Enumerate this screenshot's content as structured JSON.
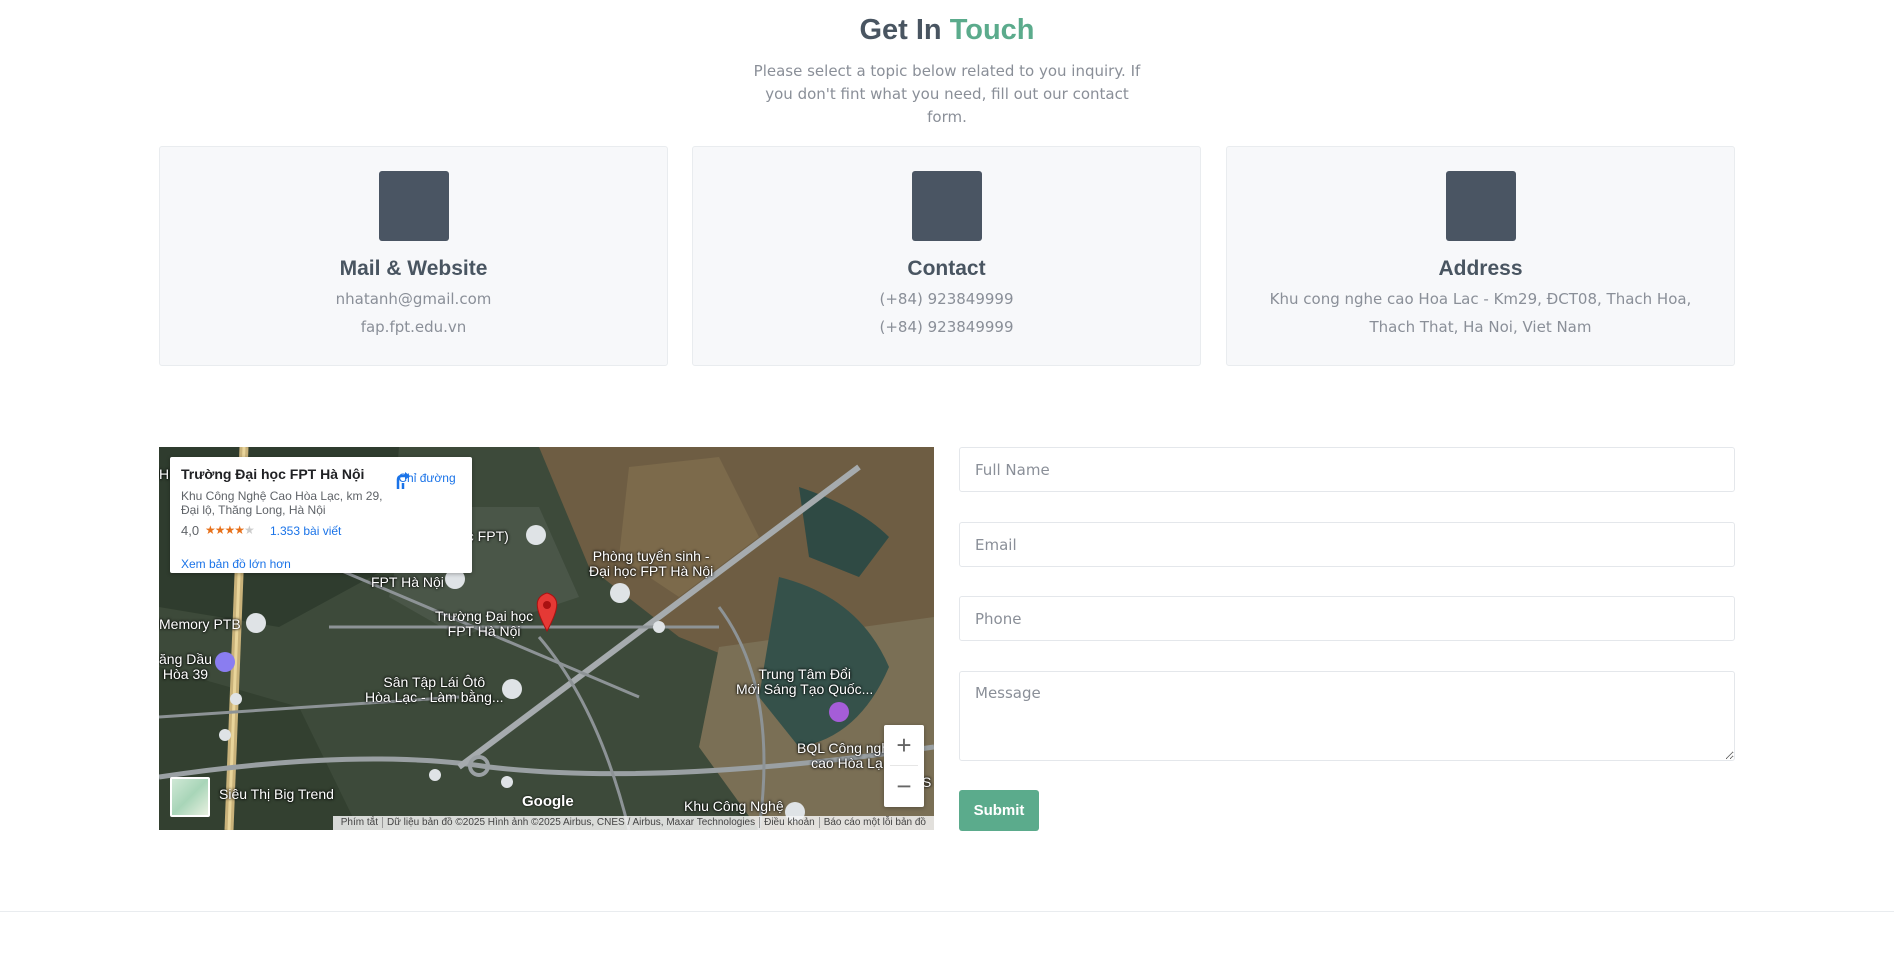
{
  "heading": {
    "part1": "Get In",
    "part2": "Touch"
  },
  "subtitle": "Please select a topic below related to you inquiry. If you don't fint what you need, fill out our contact form.",
  "cards": [
    {
      "title": "Mail & Website",
      "lines": [
        "nhatanh@gmail.com",
        "fap.fpt.edu.vn"
      ]
    },
    {
      "title": "Contact",
      "lines": [
        "(+84) 923849999",
        "(+84) 923849999"
      ]
    },
    {
      "title": "Address",
      "lines": [
        "Khu cong nghe cao Hoa Lac - Km29, ĐCT08, Thach Hoa, Thach That, Ha Noi, Viet Nam"
      ]
    }
  ],
  "map": {
    "place_name": "Trường Đại học FPT Hà Nội",
    "place_address": "Khu Công Nghệ Cao Hòa Lạc, km 29, Đại lộ, Thăng Long, Hà Nội",
    "rating": "4,0",
    "stars": "★★★★",
    "star_dim": "★",
    "reviews": "1.353 bài viết",
    "directions": "Chỉ đường",
    "bigger_map": "Xem bản đồ lớn hơn",
    "labels": {
      "fpt_top": "ọc FPT)",
      "admissions": "Phòng tuyển sinh -\nĐại học FPT Hà Nội",
      "fpt_left": "FPT Hà Nội",
      "memory": "Memory PTB",
      "truong": "Trường Đại học\nFPT Hà Nội",
      "gas": "ăng Dầu\nHòa 39",
      "driving": "Sân Tập Lái Ôtô\nHòa Lạc - Làm bằng...",
      "innovation": "Trung Tâm Đổi\nMới Sáng Tạo Quốc...",
      "bql": "BQL Công nghệ\ncao Hòa Lạ",
      "bigtrend": "Siêu Thị Big Trend",
      "khucn": "Khu Công Nghệ",
      "h": "H",
      "s": "S"
    },
    "google": "Google",
    "zoom_in": "+",
    "zoom_out": "−",
    "attribution": [
      "Phím tắt",
      "Dữ liệu bản đồ ©2025 Hình ảnh ©2025 Airbus, CNES / Airbus, Maxar Technologies",
      "Điều khoản",
      "Báo cáo một lỗi bản đồ"
    ]
  },
  "form": {
    "name_placeholder": "Full Name",
    "email_placeholder": "Email",
    "phone_placeholder": "Phone",
    "message_placeholder": "Message",
    "submit": "Submit"
  },
  "colors": {
    "accent": "#5bab8c",
    "icon_box": "#4a5563",
    "heading": "#495561"
  }
}
